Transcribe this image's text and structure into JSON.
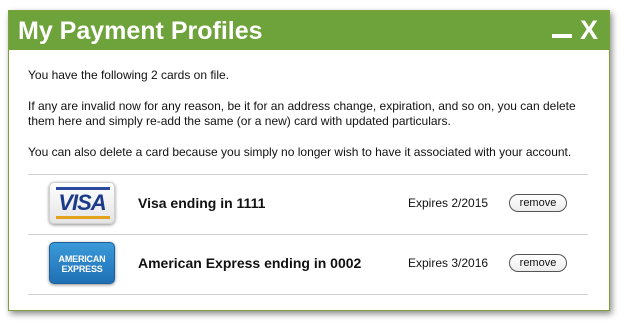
{
  "window": {
    "title": "My Payment Profiles",
    "close_label": "X",
    "accent_color": "#6ea23a"
  },
  "intro": {
    "line1": "You have the following 2 cards on file.",
    "line2a": "If any are invalid now for any reason, be it for an address change, expiration, and so on, you can delete",
    "line2b": "them here and simply re-add the same (or a new) card with updated particulars.",
    "line3": "You can also delete a card because you simply no longer wish to have it associated with your account."
  },
  "cards": [
    {
      "logo": "visa-logo",
      "logo_text": "VISA",
      "name": "Visa ending in 1111",
      "expiry": "Expires 2/2015",
      "remove_label": "remove"
    },
    {
      "logo": "amex-logo",
      "logo_text_line1": "AMERICAN",
      "logo_text_line2": "EXPRESS",
      "name": "American Express ending in 0002",
      "expiry": "Expires 3/2016",
      "remove_label": "remove"
    }
  ]
}
